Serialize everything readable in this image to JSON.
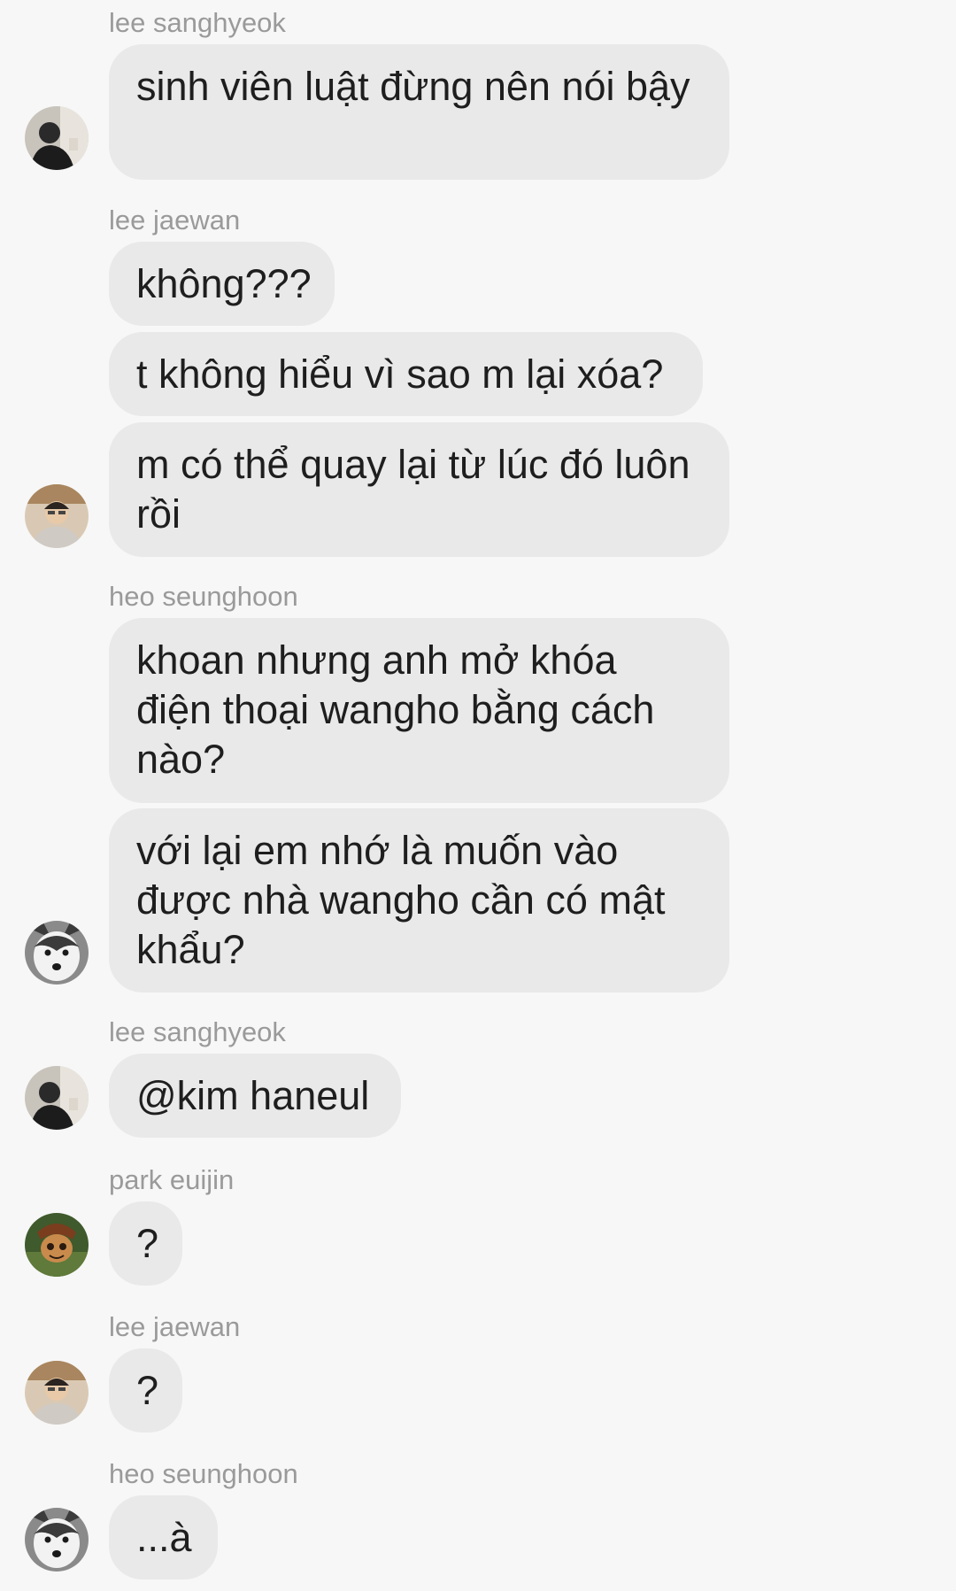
{
  "messages": [
    {
      "sender": "lee sanghyeok",
      "bubbles": [
        "sinh viên luật đừng nên nói bậy"
      ],
      "avatar": "avatar-lee-sanghyeok"
    },
    {
      "sender": "lee jaewan",
      "bubbles": [
        "không???",
        "t không hiểu vì sao m lại xóa?",
        "m có thể quay lại từ lúc đó luôn rồi"
      ],
      "avatar": "avatar-lee-jaewan"
    },
    {
      "sender": "heo seunghoon",
      "bubbles": [
        "khoan nhưng anh mở khóa điện thoại wangho bằng cách nào?",
        "với lại em nhớ là muốn vào được nhà wangho cần có mật khẩu?"
      ],
      "avatar": "avatar-heo-seunghoon"
    },
    {
      "sender": "lee sanghyeok",
      "bubbles": [
        "@kim haneul"
      ],
      "avatar": "avatar-lee-sanghyeok"
    },
    {
      "sender": "park euijin",
      "bubbles": [
        "?"
      ],
      "avatar": "avatar-park-euijin"
    },
    {
      "sender": "lee jaewan",
      "bubbles": [
        "?"
      ],
      "avatar": "avatar-lee-jaewan"
    },
    {
      "sender": "heo seunghoon",
      "bubbles": [
        "...à"
      ],
      "avatar": "avatar-heo-seunghoon"
    }
  ],
  "colors": {
    "background": "#f7f7f7",
    "bubble": "#e9e9e9",
    "sender_text": "#9a9a9a",
    "message_text": "#1e1e1e"
  }
}
